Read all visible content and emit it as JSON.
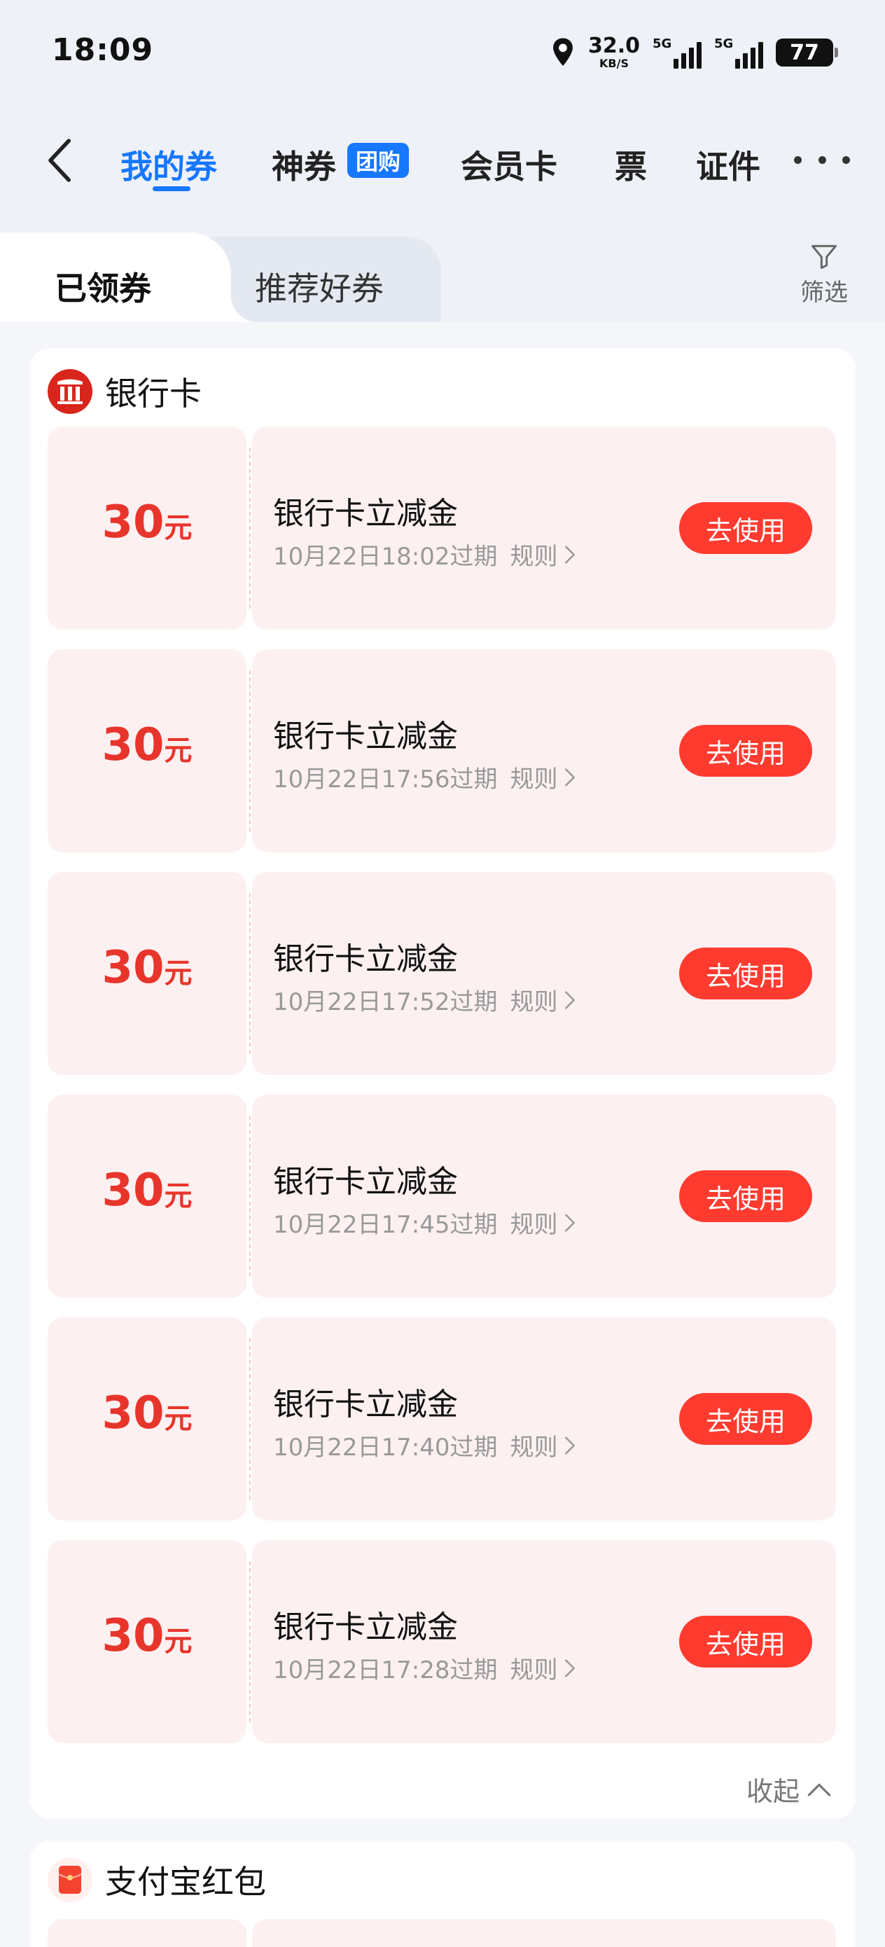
{
  "status_bar": {
    "time": "18:09",
    "net_speed_value": "32.0",
    "net_speed_unit": "KB/S",
    "sim1_label": "5G",
    "sim2_label": "5G",
    "battery": "77"
  },
  "nav": {
    "tabs": [
      {
        "label": "我的券",
        "active": true
      },
      {
        "label": "神券",
        "active": false
      },
      {
        "label": "会员卡",
        "active": false
      },
      {
        "label": "票",
        "active": false
      },
      {
        "label": "证件",
        "active": false
      }
    ],
    "badge": "团购"
  },
  "sub_tabs": {
    "active": "已领券",
    "inactive": "推荐好券",
    "filter_label": "筛选"
  },
  "bank_section": {
    "title": "银行卡",
    "coupons": [
      {
        "amount": "30",
        "unit": "元",
        "name": "银行卡立减金",
        "expiry": "10月22日18:02过期",
        "rules": "规则",
        "action": "去使用"
      },
      {
        "amount": "30",
        "unit": "元",
        "name": "银行卡立减金",
        "expiry": "10月22日17:56过期",
        "rules": "规则",
        "action": "去使用"
      },
      {
        "amount": "30",
        "unit": "元",
        "name": "银行卡立减金",
        "expiry": "10月22日17:52过期",
        "rules": "规则",
        "action": "去使用"
      },
      {
        "amount": "30",
        "unit": "元",
        "name": "银行卡立减金",
        "expiry": "10月22日17:45过期",
        "rules": "规则",
        "action": "去使用"
      },
      {
        "amount": "30",
        "unit": "元",
        "name": "银行卡立减金",
        "expiry": "10月22日17:40过期",
        "rules": "规则",
        "action": "去使用"
      },
      {
        "amount": "30",
        "unit": "元",
        "name": "银行卡立减金",
        "expiry": "10月22日17:28过期",
        "rules": "规则",
        "action": "去使用"
      }
    ],
    "collapse_label": "收起"
  },
  "redpacket_section": {
    "title": "支付宝红包"
  },
  "colors": {
    "accent_blue": "#1677ff",
    "coupon_red": "#e8352b",
    "button_red": "#ff3b2f",
    "coupon_bg": "#fdf0f1"
  }
}
